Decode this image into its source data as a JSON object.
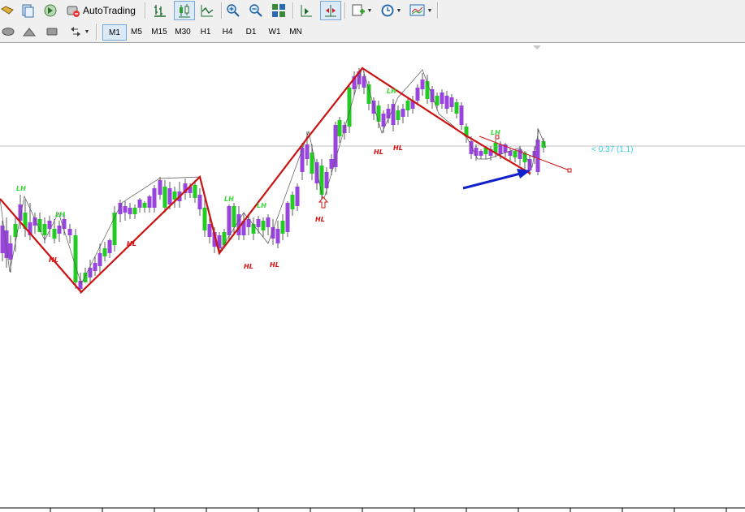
{
  "toolbar": {
    "autotrading_label": "AutoTrading",
    "icons": [
      "folder-icon",
      "profiles-icon",
      "market-watch-icon",
      "autotrading-icon",
      "bar-chart-icon",
      "candlestick-icon",
      "line-chart-icon",
      "zoom-in-icon",
      "zoom-out-icon",
      "tile-windows-icon",
      "chart-shift-icon",
      "autoscroll-icon",
      "indicators-icon",
      "periods-icon",
      "templates-icon"
    ]
  },
  "drawing_tools": [
    "ellipse-icon",
    "triangle-icon",
    "rectangle-icon",
    "arrows-icon"
  ],
  "timeframes": [
    "M1",
    "M5",
    "M15",
    "M30",
    "H1",
    "H4",
    "D1",
    "W1",
    "MN"
  ],
  "chart": {
    "timer_text": "< 0:37 (1.1)",
    "pivot_labels": [
      {
        "text": "LH",
        "kind": "high"
      },
      {
        "text": "HL",
        "kind": "low"
      },
      {
        "text": "LH",
        "kind": "high"
      },
      {
        "text": "HL",
        "kind": "low"
      },
      {
        "text": "LH",
        "kind": "high"
      },
      {
        "text": "LH",
        "kind": "high"
      },
      {
        "text": "HL",
        "kind": "low"
      },
      {
        "text": "HL",
        "kind": "low"
      },
      {
        "text": "HL",
        "kind": "low"
      },
      {
        "text": "LH",
        "kind": "high"
      },
      {
        "text": "HL",
        "kind": "low"
      },
      {
        "text": "HL",
        "kind": "low"
      },
      {
        "text": "LH",
        "kind": "high"
      }
    ],
    "colors": {
      "bull": "#22cc22",
      "bear": "#9944dd",
      "zigzag": "#cc1111",
      "arrow": "#1122cc",
      "high_label": "#33dd33",
      "low_label": "#dd1111",
      "timer": "#35d0e6"
    }
  }
}
